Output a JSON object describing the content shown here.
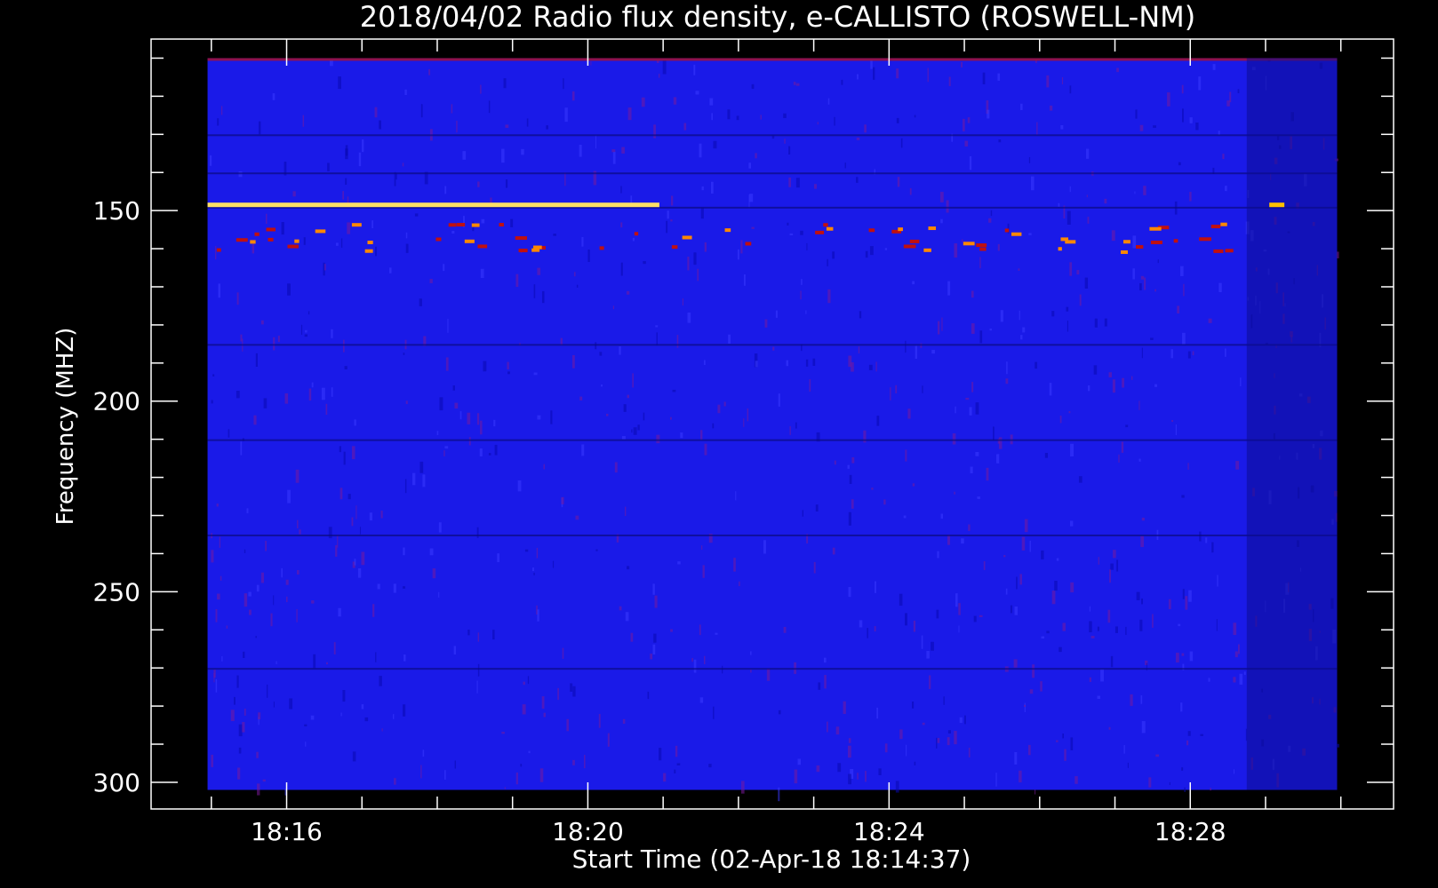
{
  "chart_data": {
    "type": "heatmap",
    "title": "2018/04/02  Radio flux density, e-CALLISTO (ROSWELL-NM)",
    "xlabel": "Start Time (02-Apr-18 18:14:37)",
    "ylabel": "Frequency (MHZ)",
    "x_ticks": [
      {
        "label": "18:16",
        "minutes": 16
      },
      {
        "label": "18:20",
        "minutes": 20
      },
      {
        "label": "18:24",
        "minutes": 24
      },
      {
        "label": "18:28",
        "minutes": 28
      }
    ],
    "y_ticks": [
      {
        "label": "150",
        "value": 150
      },
      {
        "label": "200",
        "value": 200
      },
      {
        "label": "250",
        "value": 250
      },
      {
        "label": "300",
        "value": 300
      }
    ],
    "x_range_minutes": [
      14.2,
      30.7
    ],
    "data_x_range_minutes": [
      14.95,
      29.95
    ],
    "y_range_mhz": [
      105,
      307
    ],
    "data_y_range_mhz": [
      110,
      302
    ],
    "y_inverted": true,
    "background_color": "#1a1ae8",
    "colors": {
      "low": "#0a0a50",
      "mid": "#2020ff",
      "red": "#c01010",
      "high": "#ffdd00"
    },
    "features": [
      {
        "name": "persistent band",
        "freq_mhz": 148.5,
        "t_start_min": 14.95,
        "t_end_min": 20.95,
        "color": "#ffe066"
      },
      {
        "name": "persistent band",
        "freq_mhz": 148.5,
        "t_start_min": 29.05,
        "t_end_min": 29.25,
        "color": "#ffc000"
      }
    ]
  }
}
